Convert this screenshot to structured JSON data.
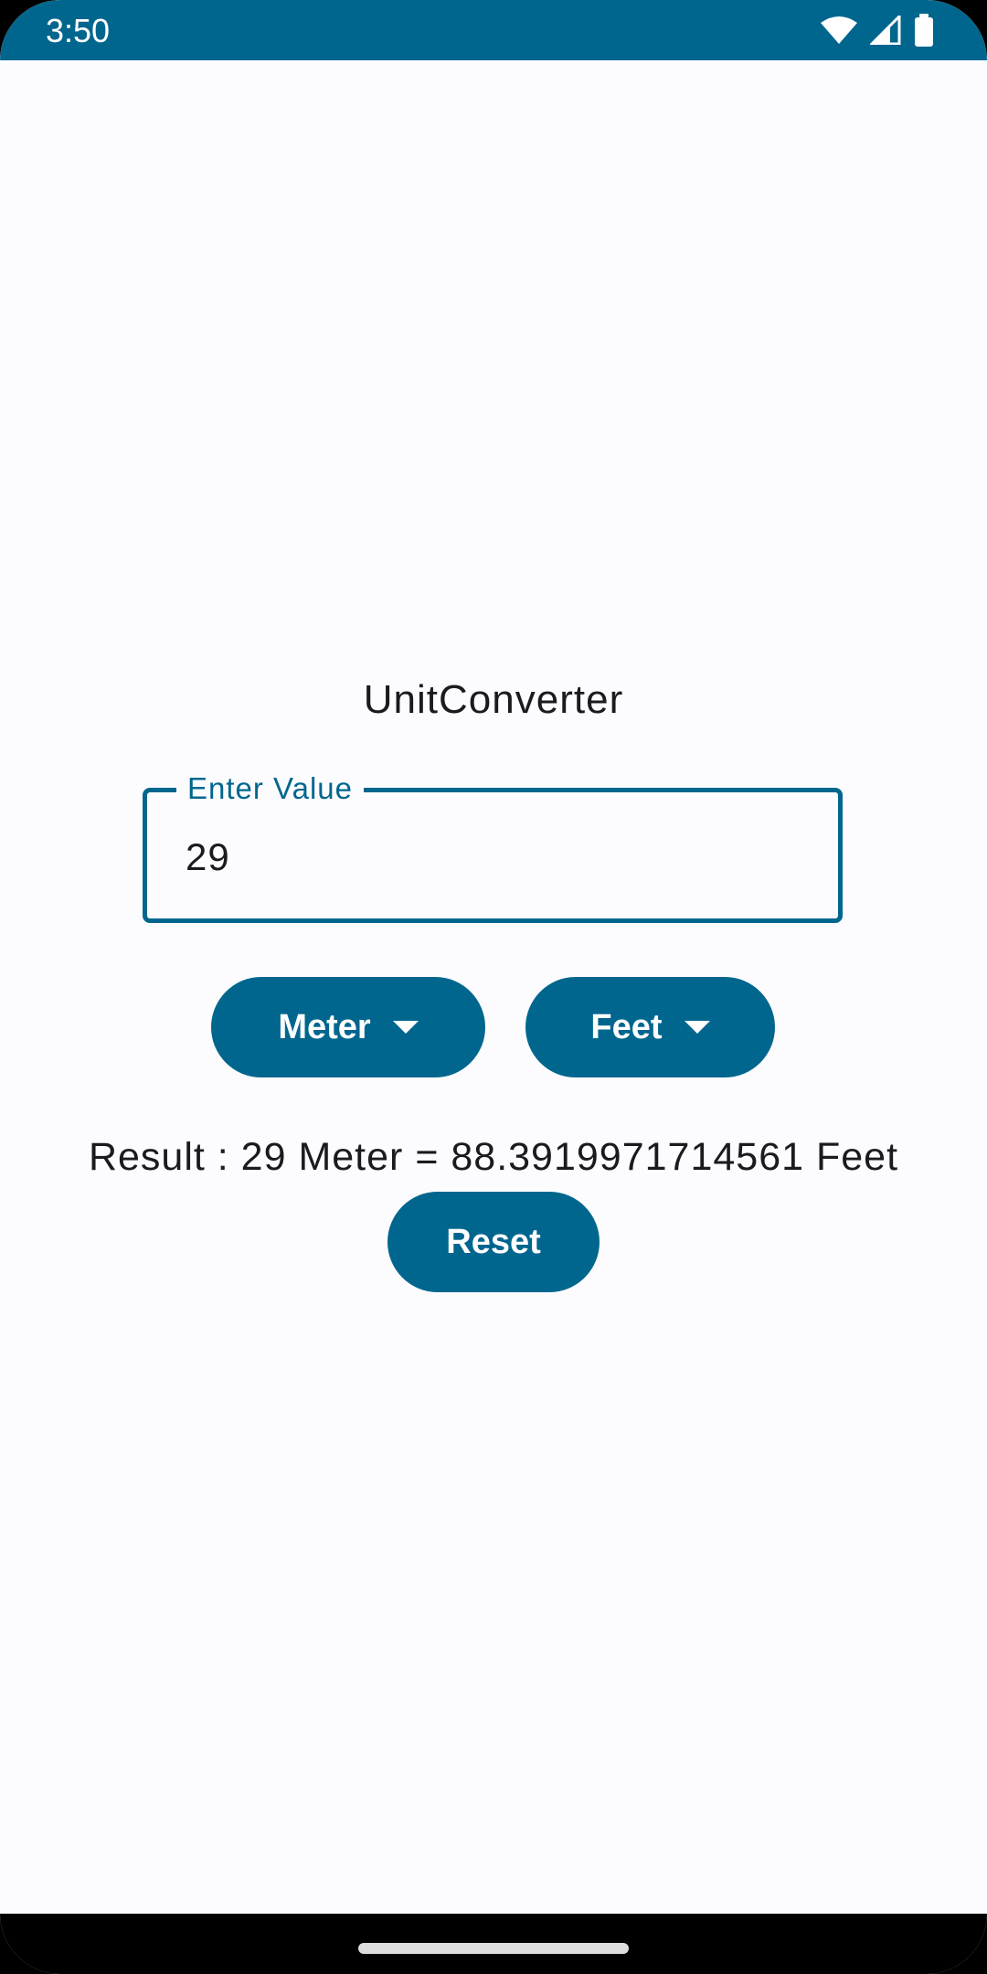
{
  "status_bar": {
    "time": "3:50",
    "icons": [
      "wifi-icon",
      "cellular-signal-icon",
      "battery-icon"
    ],
    "background": "#00668e"
  },
  "app": {
    "title": "UnitConverter",
    "input": {
      "label": "Enter Value",
      "value": "29"
    },
    "from_unit": "Meter",
    "to_unit": "Feet",
    "result": "Result : 29 Meter = 88.3919971714561 Feet",
    "reset_label": "Reset",
    "accent_color": "#00668e"
  }
}
